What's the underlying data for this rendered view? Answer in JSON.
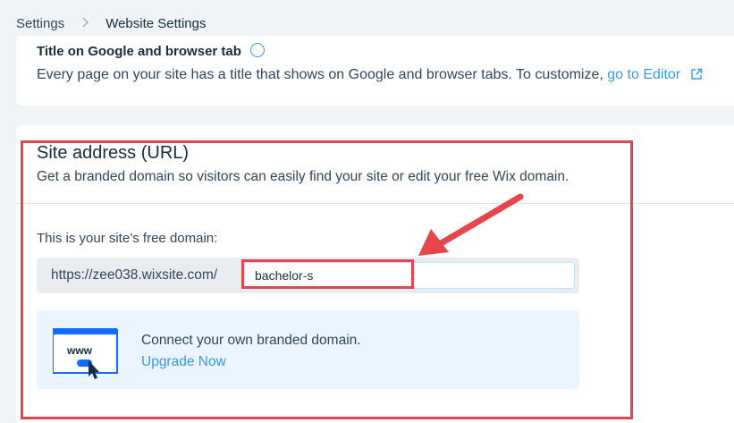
{
  "breadcrumb": {
    "root": "Settings",
    "current": "Website Settings"
  },
  "title_section": {
    "title": "Title on Google and browser tab",
    "description": "Every page on your site has a title that shows on Google and browser tabs. To customize,",
    "link": "go to Editor"
  },
  "site_address": {
    "title": "Site address (URL)",
    "subtitle": "Get a branded domain so visitors can easily find your site or edit your free Wix domain.",
    "free_domain_label": "This is your site’s free domain:",
    "domain_prefix": "https://zee038.wixsite.com/",
    "slug_value": "bachelor-s"
  },
  "promo": {
    "icon_text": "www",
    "text": "Connect your own branded domain.",
    "link": "Upgrade Now"
  },
  "colors": {
    "accent": "#3899ec",
    "annotation_red": "#e5454b"
  }
}
